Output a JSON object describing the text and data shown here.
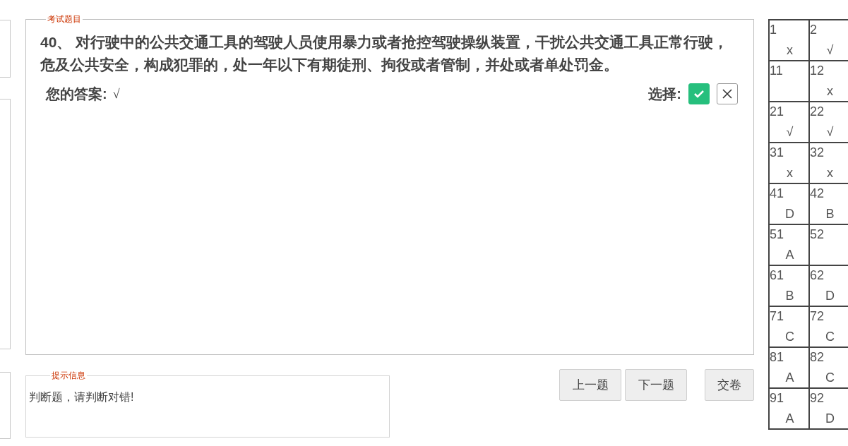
{
  "question": {
    "legend": "考试题目",
    "text": "40、 对行驶中的公共交通工具的驾驶人员使用暴力或者抢控驾驶操纵装置，干扰公共交通工具正常行驶，危及公共安全，构成犯罪的，处一年以下有期徒刑、拘役或者管制，并处或者单处罚金。",
    "answer_label": "您的答案:",
    "answer_value": "√",
    "choice_label": "选择:",
    "choices": [
      {
        "kind": "check",
        "selected": true
      },
      {
        "kind": "cross",
        "selected": false
      }
    ]
  },
  "hint": {
    "legend": "提示信息",
    "text": "判断题，请判断对错!"
  },
  "buttons": [
    {
      "label": "上一题"
    },
    {
      "label": "下一题"
    },
    {
      "label": "交卷"
    }
  ],
  "answer_grid": [
    {
      "number": "1",
      "answer": "x"
    },
    {
      "number": "2",
      "answer": "√"
    },
    {
      "number": "11"
    },
    {
      "number": "12",
      "answer": "x"
    },
    {
      "number": "21",
      "answer": "√"
    },
    {
      "number": "22",
      "answer": "√"
    },
    {
      "number": "31",
      "answer": "x"
    },
    {
      "number": "32",
      "answer": "x"
    },
    {
      "number": "41",
      "answer": "D"
    },
    {
      "number": "42",
      "answer": "B"
    },
    {
      "number": "51",
      "answer": "A"
    },
    {
      "number": "52"
    },
    {
      "number": "61",
      "answer": "B"
    },
    {
      "number": "62",
      "answer": "D"
    },
    {
      "number": "71",
      "answer": "C"
    },
    {
      "number": "72",
      "answer": "C"
    },
    {
      "number": "81",
      "answer": "A"
    },
    {
      "number": "82",
      "answer": "C"
    },
    {
      "number": "91",
      "answer": "A"
    },
    {
      "number": "92",
      "answer": "D"
    }
  ]
}
